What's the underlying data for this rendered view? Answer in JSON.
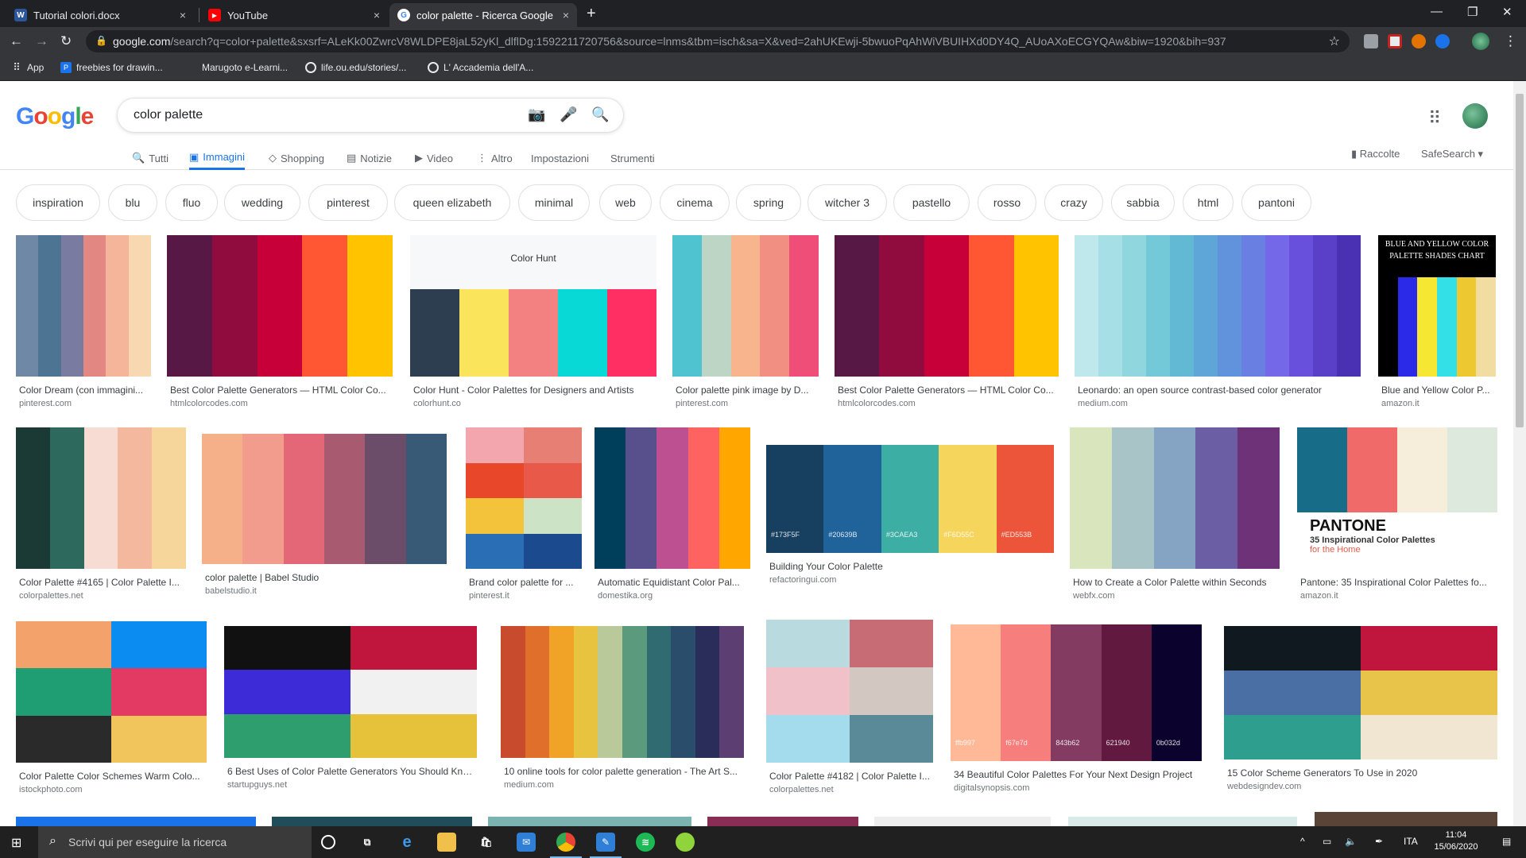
{
  "browser": {
    "tabs": [
      {
        "title": "Tutorial colori.docx",
        "favicon_letter": "W",
        "favicon_color": "#2b579a"
      },
      {
        "title": "YouTube",
        "favicon_letter": "▶",
        "favicon_color": "#ff0000"
      },
      {
        "title": "color palette - Ricerca Google",
        "favicon_letter": "G",
        "favicon_color": "#4285f4"
      }
    ],
    "close_glyph": "×",
    "newtab_glyph": "+",
    "url_host": "google.com",
    "url_path": "/search?q=color+palette&sxsrf=ALeKk00ZwrcV8WLDPE8jaL52yKl_dlflDg:1592211720756&source=lnms&tbm=isch&sa=X&ved=2ahUKEwji-5bwuoPqAhWiVBUIHXd0DY4Q_AUoAXoECGYQAw&biw=1920&bih=937",
    "bookmarks": [
      "App",
      "freebies for drawin...",
      "Marugoto e-Learni...",
      "life.ou.edu/stories/...",
      "L' Accademia dell'A..."
    ]
  },
  "google": {
    "logo_letters": [
      "G",
      "o",
      "o",
      "g",
      "l",
      "e"
    ],
    "logo_colors": [
      "#4285f4",
      "#ea4335",
      "#fbbc05",
      "#4285f4",
      "#34a853",
      "#ea4335"
    ],
    "query": "color palette",
    "tabs": [
      "Tutti",
      "Immagini",
      "Shopping",
      "Notizie",
      "Video",
      "Altro",
      "Impostazioni",
      "Strumenti"
    ],
    "tab_icons": [
      "🔍",
      "▣",
      "◇",
      "▤",
      "▶",
      "⋮",
      "",
      ""
    ],
    "active_tab_index": 1,
    "raccolte": "Raccolte",
    "safesearch": "SafeSearch ▾",
    "chips": [
      "inspiration",
      "blu",
      "fluo",
      "wedding",
      "pinterest",
      "queen elizabeth",
      "minimal",
      "web",
      "cinema",
      "spring",
      "witcher 3",
      "pastello",
      "rosso",
      "crazy",
      "sabbia",
      "html",
      "pantoni"
    ]
  },
  "results": [
    {
      "caption": "Color Dream (con immagini...",
      "source": "pinterest.com",
      "colors": [
        "#6e88a6",
        "#4e7494",
        "#7a7ba0",
        "#e38783",
        "#f5b59a",
        "#f7d8b0"
      ]
    },
    {
      "caption": "Best Color Palette Generators — HTML Color Co...",
      "source": "htmlcolorcodes.com",
      "colors": [
        "#581845",
        "#900c3f",
        "#c70039",
        "#ff5733",
        "#ffc300"
      ]
    },
    {
      "caption": "Color Hunt - Color Palettes for Designers and Artists",
      "source": "colorhunt.co",
      "colors": [
        "#2c3e50",
        "#f9e45b",
        "#f38181",
        "#08d9d6",
        "#ff2e63"
      ],
      "overlay": "Color Hunt"
    },
    {
      "caption": "Color palette pink image by D...",
      "source": "pinterest.com",
      "colors": [
        "#4fc3cf",
        "#bcd5c4",
        "#f7b48d",
        "#f28f83",
        "#ef4e79"
      ]
    },
    {
      "caption": "Best Color Palette Generators — HTML Color Co...",
      "source": "htmlcolorcodes.com",
      "colors": [
        "#581845",
        "#900c3f",
        "#c70039",
        "#ff5733",
        "#ffc300"
      ]
    },
    {
      "caption": "Leonardo: an open source contrast-based color generator",
      "source": "medium.com",
      "colors": [
        "#bfe8ec",
        "#a6e0e6",
        "#8fd6df",
        "#74c9d8",
        "#62b9d4",
        "#5ea6d8",
        "#6193dc",
        "#6a7fe2",
        "#7467e8",
        "#6950dc",
        "#5a40c9",
        "#4a31b3"
      ]
    },
    {
      "caption": "Blue and Yellow Color P...",
      "source": "amazon.it",
      "colors": [
        "#000000",
        "#2a2ae8",
        "#f6e832",
        "#34e0e8",
        "#eec830",
        "#f1dca2"
      ],
      "overlay": "BLUE AND YELLOW COLOR PALETTE SHADES CHART"
    },
    {
      "caption": "Color Palette #4165 | Color Palette I...",
      "source": "colorpalettes.net",
      "colors": [
        "#1b3a36",
        "#2d6a5d",
        "#f6dcd2",
        "#f3b89e",
        "#f6d69b"
      ]
    },
    {
      "caption": "color palette | Babel Studio",
      "source": "babelstudio.it",
      "colors": [
        "#f5b08a",
        "#f19c8c",
        "#e46778",
        "#a85a70",
        "#6b4d6a",
        "#385a76"
      ]
    },
    {
      "caption": "Brand color palette for ...",
      "source": "pinterest.it",
      "colors": [
        "#f3a6ad",
        "#e87f74",
        "#e8472a",
        "#e8594a",
        "#f3c33c",
        "#cde3c5",
        "#2a6fb5",
        "#1c4a8e"
      ]
    },
    {
      "caption": "Automatic Equidistant Color Pal...",
      "source": "domestika.org",
      "colors": [
        "#003f5c",
        "#58508d",
        "#bc5090",
        "#ff6361",
        "#ffa600"
      ]
    },
    {
      "caption": "Building Your Color Palette",
      "source": "refactoringui.com",
      "colors": [
        "#173f5f",
        "#20639b",
        "#3caea3",
        "#f6d55c",
        "#ed553b"
      ],
      "labels": [
        "#173F5F",
        "#20639B",
        "#3CAEA3",
        "#F6D55C",
        "#ED553B"
      ]
    },
    {
      "caption": "How to Create a Color Palette within Seconds",
      "source": "webfx.com",
      "colors": [
        "#d8e5bd",
        "#a9c4c6",
        "#85a3c2",
        "#6c5ea5",
        "#6e3278"
      ]
    },
    {
      "caption": "Pantone: 35 Inspirational Color Palettes fo...",
      "source": "amazon.it",
      "colors": [
        "#176c87",
        "#f06a6a",
        "#f6edda",
        "#dde9dd"
      ],
      "overlay": "PANTONE",
      "sub1": "35 Inspirational Color Palettes",
      "sub2": "for the Home"
    },
    {
      "caption": "Color Palette Color Schemes Warm Colo...",
      "source": "istockphoto.com",
      "colors": [
        "#f4a26b",
        "#0a8cf1",
        "#1e9e72",
        "#e23a62",
        "#2a2a2a",
        "#f1c55b"
      ]
    },
    {
      "caption": "6 Best Uses of Color Palette Generators You Should Kno...",
      "source": "startupguys.net",
      "colors": [
        "#111111",
        "#c0153c",
        "#3d2bd7",
        "#f1f1f1",
        "#2e9e6e",
        "#e6c23a"
      ]
    },
    {
      "caption": "10 online tools for color palette generation - The Art S...",
      "source": "medium.com",
      "colors": [
        "#c94b2e",
        "#e06f2b",
        "#f0a327",
        "#e8c33f",
        "#b9c99a",
        "#5c9a7d",
        "#2f6b70",
        "#294d6b",
        "#2a2c5a",
        "#5d3e73"
      ]
    },
    {
      "caption": "Color Palette #4182 | Color Palette I...",
      "source": "colorpalettes.net",
      "colors": [
        "#b9dbe0",
        "#c76b75",
        "#f0c1c8",
        "#d3c7c2",
        "#a5dced",
        "#5a8a98"
      ]
    },
    {
      "caption": "34 Beautiful Color Palettes For Your Next Design Project",
      "source": "digitalsynopsis.com",
      "colors": [
        "#ffb997",
        "#f67e7d",
        "#843b62",
        "#621940",
        "#0b032d"
      ],
      "labels": [
        "ffb997",
        "f67e7d",
        "843b62",
        "621940",
        "0b032d"
      ]
    },
    {
      "caption": "15 Color Scheme Generators To Use in 2020",
      "source": "webdesigndev.com",
      "colors": [
        "#101820",
        "#c0153c",
        "#4a6fa5",
        "#e8c44a",
        "#2e9e8e",
        "#f0e6d2"
      ]
    }
  ],
  "taskbar": {
    "search_placeholder": "Scrivi qui per eseguire la ricerca",
    "language": "ITA",
    "time": "11:04",
    "date": "15/06/2020"
  }
}
